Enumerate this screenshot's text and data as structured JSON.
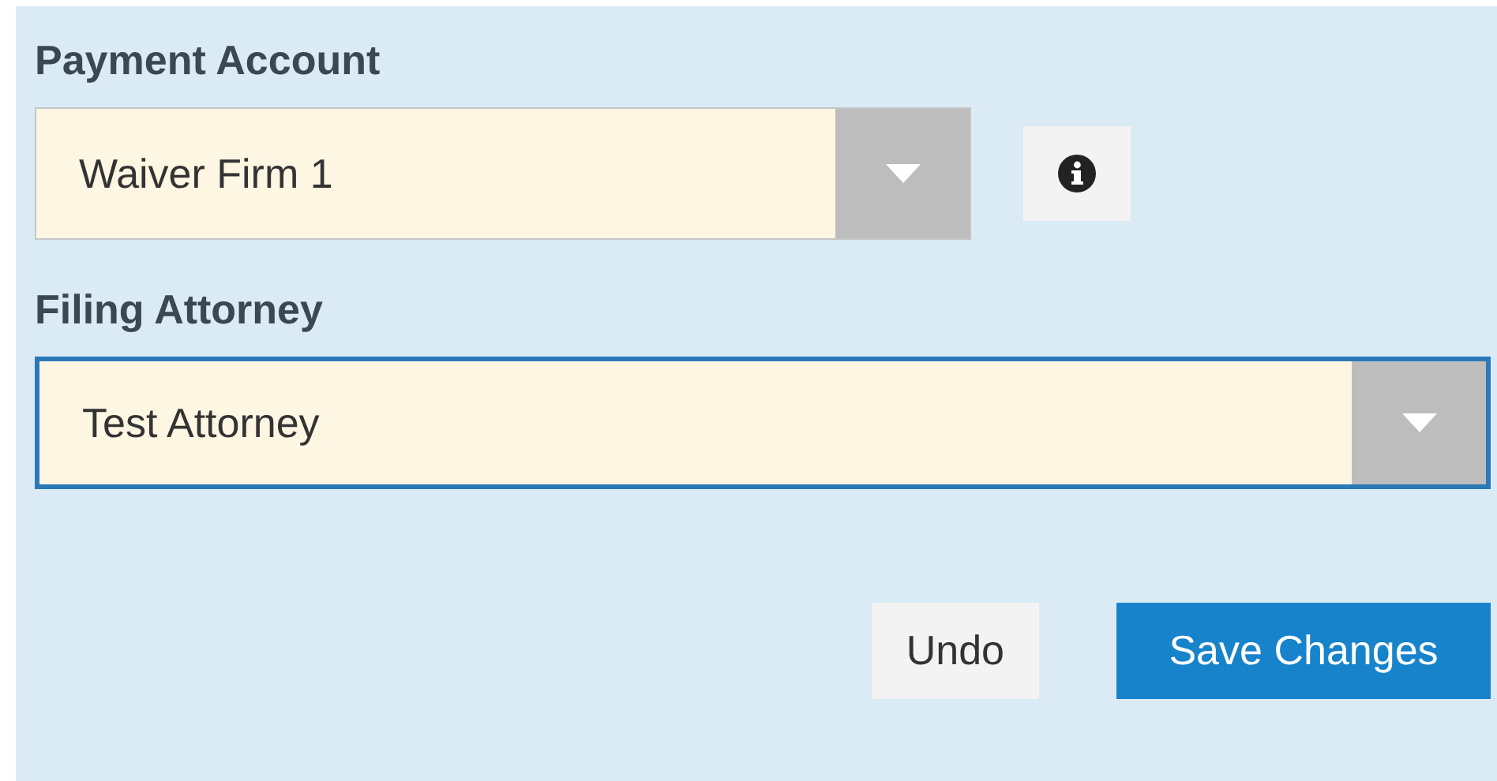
{
  "fields": [
    {
      "label": "Payment Account",
      "value": "Waiver Firm 1",
      "focused": false,
      "info_button": true
    },
    {
      "label": "Filing Attorney",
      "value": "Test Attorney",
      "focused": true,
      "info_button": false
    }
  ],
  "buttons": [
    {
      "label": "Undo",
      "kind": "secondary"
    },
    {
      "label": "Save Changes",
      "kind": "primary"
    }
  ]
}
